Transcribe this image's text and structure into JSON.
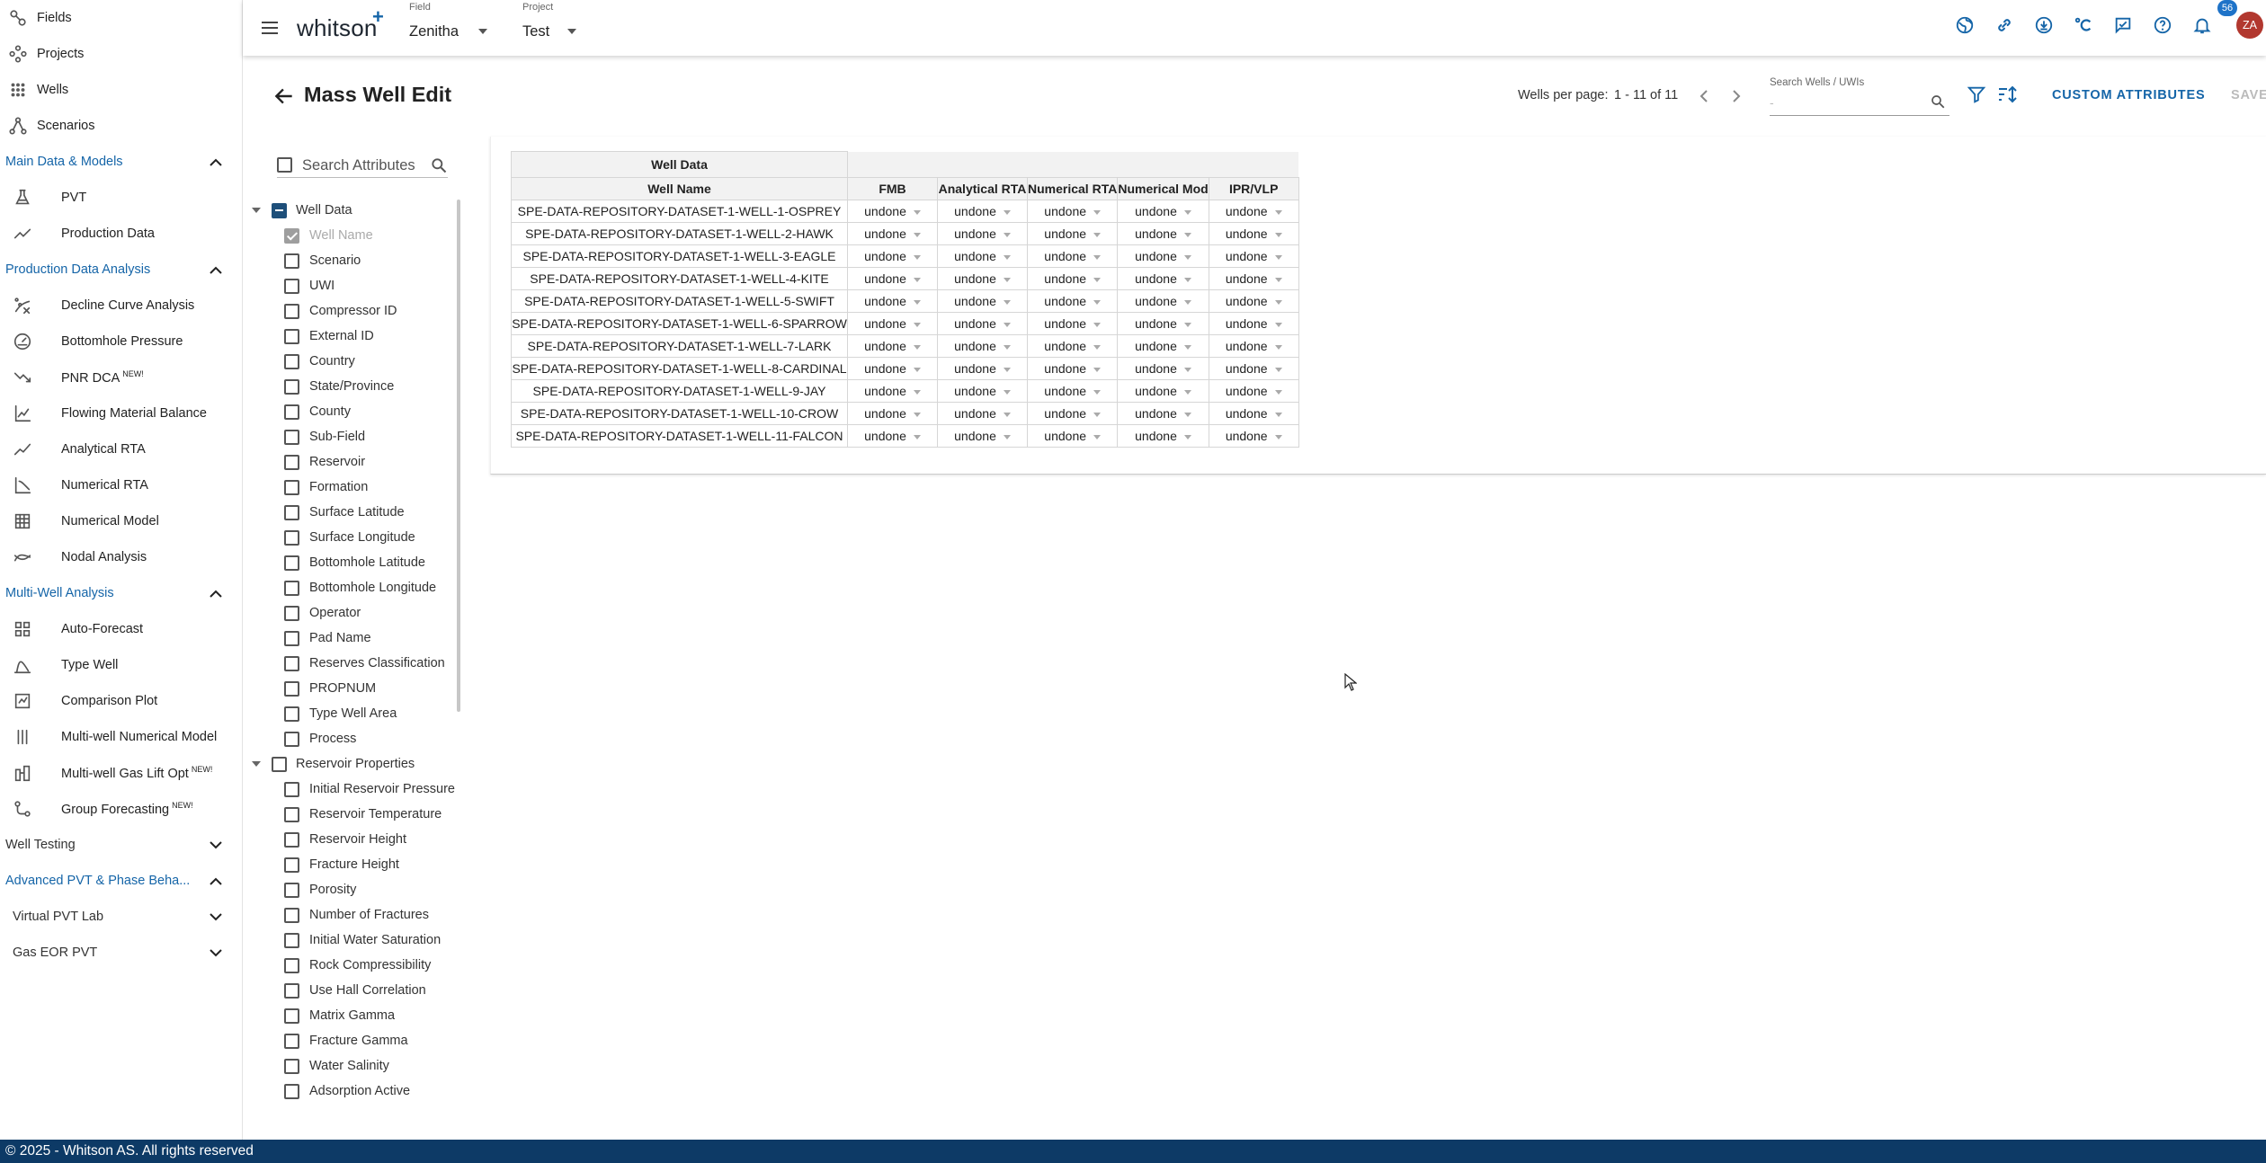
{
  "topbar": {
    "brand": "whitson",
    "brand_plus": "+",
    "field_caption": "Field",
    "field_value": "Zenitha",
    "project_caption": "Project",
    "project_value": "Test",
    "notification_count": "56",
    "avatar_initials": "ZA"
  },
  "nav": {
    "top": [
      {
        "label": "Fields",
        "icon": "fields-icon"
      },
      {
        "label": "Projects",
        "icon": "projects-icon"
      },
      {
        "label": "Wells",
        "icon": "wells-icon"
      },
      {
        "label": "Scenarios",
        "icon": "scenarios-icon"
      }
    ],
    "sections": [
      {
        "label": "Main Data & Models",
        "expanded": true,
        "items": [
          {
            "label": "PVT",
            "icon": "flask-icon",
            "badge": ""
          },
          {
            "label": "Production Data",
            "icon": "trend-icon",
            "badge": ""
          }
        ]
      },
      {
        "label": "Production Data Analysis",
        "expanded": true,
        "items": [
          {
            "label": "Decline Curve Analysis",
            "icon": "decline-icon",
            "badge": ""
          },
          {
            "label": "Bottomhole Pressure",
            "icon": "gauge-icon",
            "badge": ""
          },
          {
            "label": "PNR DCA",
            "icon": "pnr-icon",
            "badge": "NEW!"
          },
          {
            "label": "Flowing Material Balance",
            "icon": "fmb-icon",
            "badge": ""
          },
          {
            "label": "Analytical RTA",
            "icon": "analytical-rta-icon",
            "badge": ""
          },
          {
            "label": "Numerical RTA",
            "icon": "numerical-rta-icon",
            "badge": ""
          },
          {
            "label": "Numerical Model",
            "icon": "grid-model-icon",
            "badge": ""
          },
          {
            "label": "Nodal Analysis",
            "icon": "nodal-icon",
            "badge": ""
          }
        ]
      },
      {
        "label": "Multi-Well Analysis",
        "expanded": true,
        "items": [
          {
            "label": "Auto-Forecast",
            "icon": "auto-forecast-icon",
            "badge": ""
          },
          {
            "label": "Type Well",
            "icon": "type-well-icon",
            "badge": ""
          },
          {
            "label": "Comparison Plot",
            "icon": "comparison-icon",
            "badge": ""
          },
          {
            "label": "Multi-well Numerical Model",
            "icon": "multiwell-model-icon",
            "badge": ""
          },
          {
            "label": "Multi-well Gas Lift Opt",
            "icon": "gas-lift-icon",
            "badge": "NEW!"
          },
          {
            "label": "Group Forecasting",
            "icon": "group-forecast-icon",
            "badge": "NEW!"
          }
        ]
      }
    ],
    "well_testing": "Well Testing",
    "advanced_pvt": "Advanced PVT & Phase Beha...",
    "virtual_pvt_lab": "Virtual PVT Lab",
    "gas_eor_pvt": "Gas EOR PVT"
  },
  "page": {
    "title": "Mass Well Edit",
    "wells_per_page_label": "Wells per page:",
    "wells_range": "1 - 11 of 11",
    "search_wells_caption": "Search Wells / UWIs",
    "search_wells_placeholder": "-",
    "custom_attributes": "CUSTOM ATTRIBUTES",
    "save": "SAVE"
  },
  "attributes": {
    "search_placeholder": "Search Attributes",
    "groups": [
      {
        "label": "Well Data",
        "state": "indeterminate",
        "items": [
          {
            "label": "Well Name",
            "state": "checked-disabled"
          },
          {
            "label": "Scenario",
            "state": "unchecked"
          },
          {
            "label": "UWI",
            "state": "unchecked"
          },
          {
            "label": "Compressor ID",
            "state": "unchecked"
          },
          {
            "label": "External ID",
            "state": "unchecked"
          },
          {
            "label": "Country",
            "state": "unchecked"
          },
          {
            "label": "State/Province",
            "state": "unchecked"
          },
          {
            "label": "County",
            "state": "unchecked"
          },
          {
            "label": "Sub-Field",
            "state": "unchecked"
          },
          {
            "label": "Reservoir",
            "state": "unchecked"
          },
          {
            "label": "Formation",
            "state": "unchecked"
          },
          {
            "label": "Surface Latitude",
            "state": "unchecked"
          },
          {
            "label": "Surface Longitude",
            "state": "unchecked"
          },
          {
            "label": "Bottomhole Latitude",
            "state": "unchecked"
          },
          {
            "label": "Bottomhole Longitude",
            "state": "unchecked"
          },
          {
            "label": "Operator",
            "state": "unchecked"
          },
          {
            "label": "Pad Name",
            "state": "unchecked"
          },
          {
            "label": "Reserves Classification",
            "state": "unchecked"
          },
          {
            "label": "PROPNUM",
            "state": "unchecked"
          },
          {
            "label": "Type Well Area",
            "state": "unchecked"
          },
          {
            "label": "Process",
            "state": "unchecked"
          }
        ]
      },
      {
        "label": "Reservoir Properties",
        "state": "unchecked",
        "items": [
          {
            "label": "Initial Reservoir Pressure",
            "state": "unchecked"
          },
          {
            "label": "Reservoir Temperature",
            "state": "unchecked"
          },
          {
            "label": "Reservoir Height",
            "state": "unchecked"
          },
          {
            "label": "Fracture Height",
            "state": "unchecked"
          },
          {
            "label": "Porosity",
            "state": "unchecked"
          },
          {
            "label": "Number of Fractures",
            "state": "unchecked"
          },
          {
            "label": "Initial Water Saturation",
            "state": "unchecked"
          },
          {
            "label": "Rock Compressibility",
            "state": "unchecked"
          },
          {
            "label": "Use Hall Correlation",
            "state": "unchecked"
          },
          {
            "label": "Matrix Gamma",
            "state": "unchecked"
          },
          {
            "label": "Fracture Gamma",
            "state": "unchecked"
          },
          {
            "label": "Water Salinity",
            "state": "unchecked"
          },
          {
            "label": "Adsorption Active",
            "state": "unchecked"
          }
        ]
      }
    ]
  },
  "table": {
    "group_header": "Well Data",
    "columns": [
      "Well Name",
      "FMB",
      "Analytical RTA",
      "Numerical RTA",
      "Numerical Mod",
      "IPR/VLP"
    ],
    "rows": [
      [
        "SPE-DATA-REPOSITORY-DATASET-1-WELL-1-OSPREY",
        "undone",
        "undone",
        "undone",
        "undone",
        "undone"
      ],
      [
        "SPE-DATA-REPOSITORY-DATASET-1-WELL-2-HAWK",
        "undone",
        "undone",
        "undone",
        "undone",
        "undone"
      ],
      [
        "SPE-DATA-REPOSITORY-DATASET-1-WELL-3-EAGLE",
        "undone",
        "undone",
        "undone",
        "undone",
        "undone"
      ],
      [
        "SPE-DATA-REPOSITORY-DATASET-1-WELL-4-KITE",
        "undone",
        "undone",
        "undone",
        "undone",
        "undone"
      ],
      [
        "SPE-DATA-REPOSITORY-DATASET-1-WELL-5-SWIFT",
        "undone",
        "undone",
        "undone",
        "undone",
        "undone"
      ],
      [
        "SPE-DATA-REPOSITORY-DATASET-1-WELL-6-SPARROW",
        "undone",
        "undone",
        "undone",
        "undone",
        "undone"
      ],
      [
        "SPE-DATA-REPOSITORY-DATASET-1-WELL-7-LARK",
        "undone",
        "undone",
        "undone",
        "undone",
        "undone"
      ],
      [
        "SPE-DATA-REPOSITORY-DATASET-1-WELL-8-CARDINAL",
        "undone",
        "undone",
        "undone",
        "undone",
        "undone"
      ],
      [
        "SPE-DATA-REPOSITORY-DATASET-1-WELL-9-JAY",
        "undone",
        "undone",
        "undone",
        "undone",
        "undone"
      ],
      [
        "SPE-DATA-REPOSITORY-DATASET-1-WELL-10-CROW",
        "undone",
        "undone",
        "undone",
        "undone",
        "undone"
      ],
      [
        "SPE-DATA-REPOSITORY-DATASET-1-WELL-11-FALCON",
        "undone",
        "undone",
        "undone",
        "undone",
        "undone"
      ]
    ]
  },
  "footer": {
    "text": "© 2025 - Whitson AS. All rights reserved"
  },
  "colors": {
    "accent": "#1565a8",
    "footer_bg": "#0d3a66",
    "avatar_bg": "#b2382f",
    "badge_bg": "#1e73c8"
  }
}
